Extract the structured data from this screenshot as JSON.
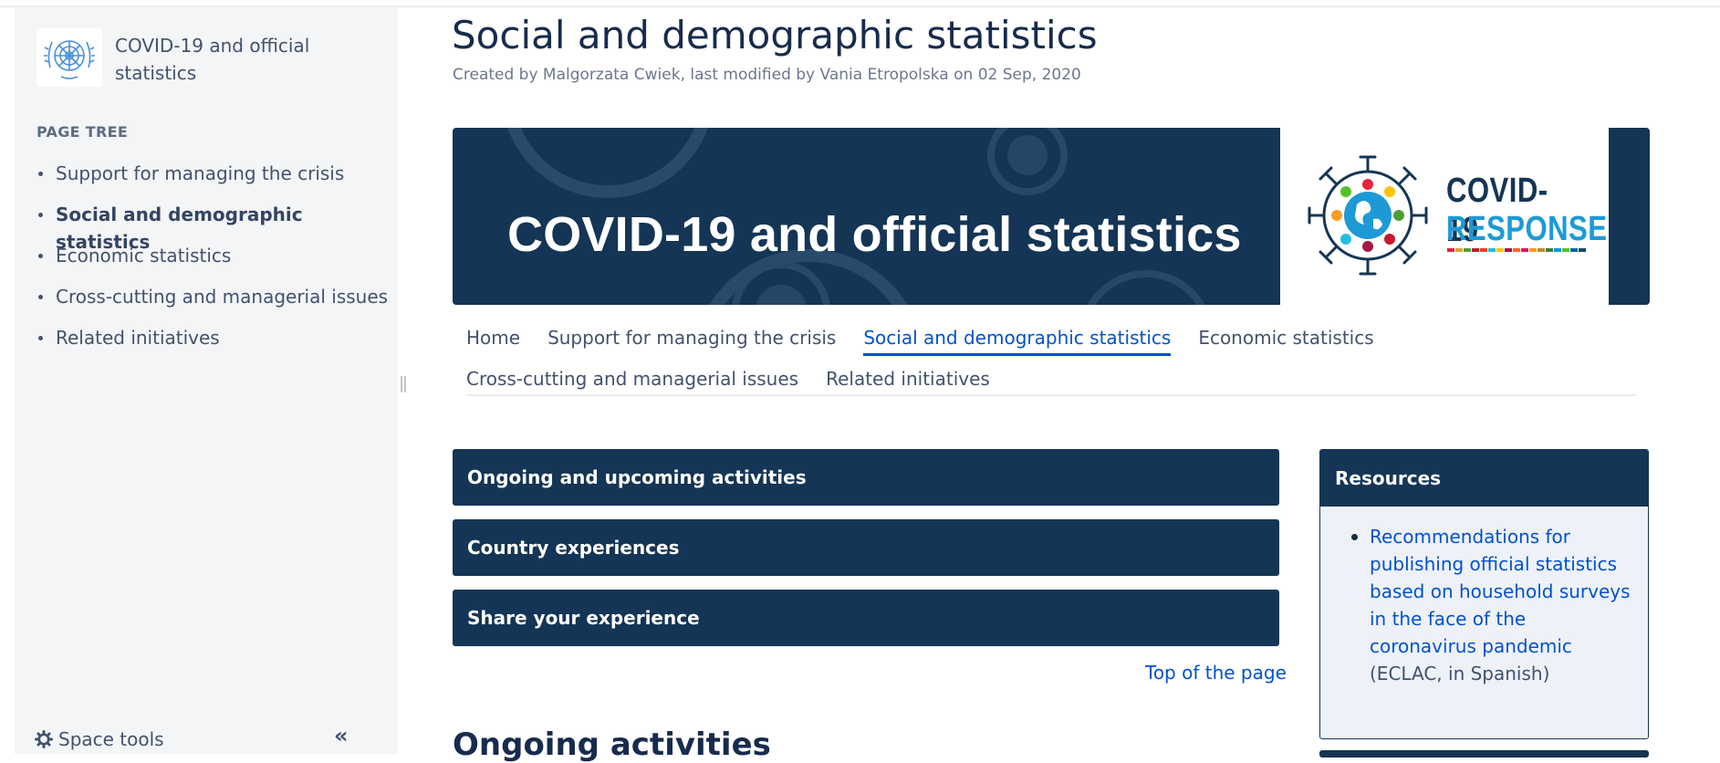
{
  "sidebar": {
    "space_title": "COVID-19 and official statistics",
    "page_tree_label": "PAGE TREE",
    "items": [
      {
        "label": "Support for managing the crisis"
      },
      {
        "label": "Social and demographic statistics",
        "current": true
      },
      {
        "label": "Economic statistics"
      },
      {
        "label": "Cross-cutting and managerial issues"
      },
      {
        "label": "Related initiatives"
      }
    ],
    "space_tools_label": "Space tools",
    "collapse_label": "«"
  },
  "page": {
    "title": "Social and demographic statistics",
    "byline": "Created by Malgorzata Cwiek, last modified by Vania Etropolska on 02 Sep, 2020"
  },
  "banner": {
    "title": "COVID-19 and official statistics",
    "logo_line1": "COVID-19",
    "logo_line2": "RESPONSE"
  },
  "nav": {
    "tabs": [
      {
        "label": "Home"
      },
      {
        "label": "Support for managing the crisis"
      },
      {
        "label": "Social and demographic statistics",
        "active": true
      },
      {
        "label": "Economic statistics"
      },
      {
        "label": "Cross-cutting and managerial issues"
      },
      {
        "label": "Related initiatives"
      }
    ]
  },
  "sections": {
    "accordions": [
      {
        "label": "Ongoing and upcoming activities"
      },
      {
        "label": "Country experiences"
      },
      {
        "label": "Share your experience"
      }
    ],
    "top_link": "Top of the page",
    "heading": "Ongoing activities"
  },
  "resources": {
    "title": "Resources",
    "items": [
      {
        "link_text": "Recommendations for publishing official statistics based on household surveys in the face of the coronavirus pandemic",
        "suffix": " (ECLAC, in Spanish)"
      }
    ]
  },
  "colors": {
    "navy": "#143555",
    "link_blue": "#0052cc",
    "sidebar_bg": "#f4f5f7",
    "response_blue": "#1d9ad6"
  }
}
